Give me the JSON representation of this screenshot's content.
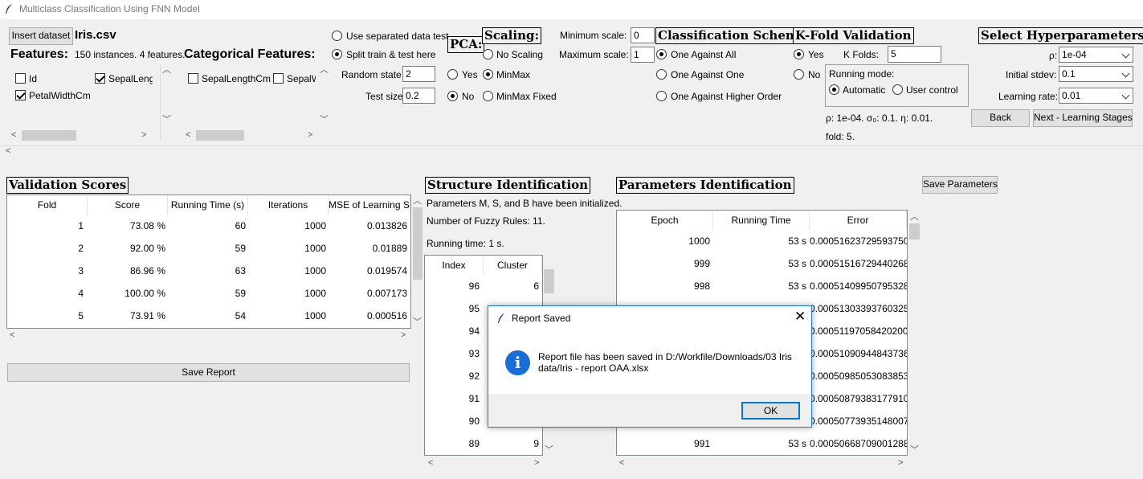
{
  "window": {
    "title": "Multiclass Classification Using FNN Model"
  },
  "dataset": {
    "insert_button": "Insert dataset",
    "filename": "Iris.csv",
    "features_heading": "Features:",
    "features_info": "150 instances. 4 features.",
    "categorical_heading": "Categorical Features:",
    "features": [
      {
        "label": "Id",
        "checked": false
      },
      {
        "label": "SepalLeng",
        "checked": true
      },
      {
        "label": "PetalWidthCm",
        "checked": true
      }
    ],
    "categorical": [
      {
        "label": "SepalLengthCm",
        "checked": false
      },
      {
        "label": "SepalW",
        "checked": false
      }
    ]
  },
  "split": {
    "separated": "Use separated data test",
    "split_here": "Split train & test here",
    "random_state_label": "Random state",
    "random_state_value": "2",
    "test_size_label": "Test size",
    "test_size_value": "0.2",
    "selected": "split_here"
  },
  "pca": {
    "heading": "PCA:",
    "yes": "Yes",
    "no": "No",
    "selected": "no"
  },
  "scaling": {
    "heading": "Scaling:",
    "options": [
      "No Scaling",
      "MinMax",
      "MinMax Fixed"
    ],
    "selected": "MinMax",
    "min_label": "Minimum scale:",
    "min_value": "0",
    "max_label": "Maximum scale:",
    "max_value": "1"
  },
  "scheme": {
    "heading": "Classification Scheme:",
    "options": [
      "One Against All",
      "One Against One",
      "One Against Higher Order"
    ],
    "selected": "One Against All"
  },
  "kfold": {
    "heading": "K-Fold Validation",
    "yes": "Yes",
    "no": "No",
    "selected": "yes",
    "kfolds_label": "K Folds:",
    "kfolds_value": "5",
    "running_mode_label": "Running mode:",
    "automatic": "Automatic",
    "user_control": "User control",
    "mode_selected": "automatic",
    "summary_line1": "ρ: 1e-04. σ₀: 0.1. η: 0.01.",
    "summary_line2": "fold: 5."
  },
  "hyper": {
    "heading": "Select Hyperparameters:",
    "rho_label": "ρ:",
    "rho_value": "1e-04",
    "stdev_label": "Initial stdev:",
    "stdev_value": "0.1",
    "lr_label": "Learning rate:",
    "lr_value": "0.01",
    "back_button": "Back",
    "next_button": "Next - Learning Stages"
  },
  "validation": {
    "heading": "Validation Scores",
    "columns": [
      "Fold",
      "Score",
      "Running Time (s)",
      "Iterations",
      "MSE of Learning S"
    ],
    "rows": [
      [
        "1",
        "73.08 %",
        "60",
        "1000",
        "0.013826"
      ],
      [
        "2",
        "92.00 %",
        "59",
        "1000",
        "0.01889"
      ],
      [
        "3",
        "86.96 %",
        "63",
        "1000",
        "0.019574"
      ],
      [
        "4",
        "100.00 %",
        "59",
        "1000",
        "0.007173"
      ],
      [
        "5",
        "73.91 %",
        "54",
        "1000",
        "0.000516"
      ]
    ],
    "save_report_button": "Save Report"
  },
  "structure": {
    "heading": "Structure Identification",
    "line1": "Parameters M, S, and B have been initialized.",
    "line2": "Number of Fuzzy Rules: 11.",
    "line3": "Running time: 1 s.",
    "columns": [
      "Index",
      "Cluster"
    ],
    "rows": [
      [
        "96",
        "6"
      ],
      [
        "95",
        ""
      ],
      [
        "94",
        ""
      ],
      [
        "93",
        ""
      ],
      [
        "92",
        ""
      ],
      [
        "91",
        ""
      ],
      [
        "90",
        ""
      ],
      [
        "89",
        "9"
      ]
    ]
  },
  "params": {
    "heading": "Parameters Identification",
    "save_button": "Save Parameters",
    "columns": [
      "Epoch",
      "Running Time",
      "Error"
    ],
    "rows": [
      [
        "1000",
        "53 s",
        "0.00051623729593750"
      ],
      [
        "999",
        "53 s",
        "0.00051516729440268"
      ],
      [
        "998",
        "53 s",
        "0.00051409950795328"
      ],
      [
        "",
        "",
        "0.00051303393760325"
      ],
      [
        "",
        "",
        "0.00051197058420200"
      ],
      [
        "",
        "",
        "0.00051090944843736"
      ],
      [
        "",
        "",
        "0.00050985053083853"
      ],
      [
        "",
        "",
        "0.00050879383177910"
      ],
      [
        "",
        "",
        "0.00050773935148007"
      ],
      [
        "991",
        "53 s",
        "0.00050668709001288"
      ]
    ]
  },
  "dialog": {
    "title": "Report Saved",
    "message": "Report file has been saved in D:/Workfile/Downloads/03 Iris data/Iris - report OAA.xlsx",
    "ok_button": "OK",
    "icon_glyph": "i"
  }
}
